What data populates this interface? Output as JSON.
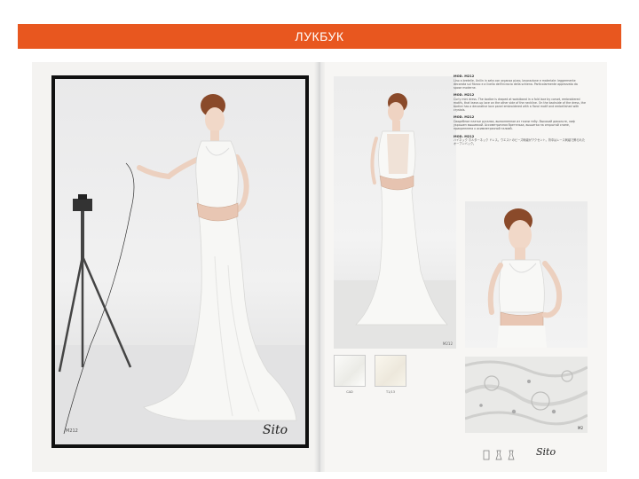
{
  "slide": {
    "title": "ЛУКБУК",
    "accent_color": "#e8571f"
  },
  "left_page": {
    "model_code": "M212",
    "signature": "Sito"
  },
  "right_page": {
    "back_view_code": "M212",
    "text_sections": [
      {
        "heading": "MOD. M212",
        "body": "Lino a bretelle, Unilin in seta con organza pizzo, lavorazione e materiale: leggermente decorata sul fianco e a livello dell'incrocio della schiena. Particolarmente apprezzato da spose moderne."
      },
      {
        "heading": "MOD. M212",
        "body": "Curly mini dress. The bodice is draped at waistband in a fold lace by corset, embroidered motifs, that leave-up lace on the other side of the neckline. On the backside of the dress, the bodice has a decorative lace panel embroidered with a floral motif and embellished with crystals."
      },
      {
        "heading": "MOD. M212",
        "body": "Свадебное платье русалка, выполненное из ткани тейу. Высокий декольте, лиф украшен вышивкой. Ассиметричная бретелька, вышитая на открытой спине, прикреплена к асимметричной талией."
      },
      {
        "heading": "MOD. M212",
        "body": "ハイネック ホルターネック ドレス。ウエストのビーズ刺繍がアクセント。背中はレース刺繍で飾られたオープンバック。"
      }
    ],
    "swatches": [
      {
        "label": "CAD",
        "color": "#f3f3ef"
      },
      {
        "label": "T1/13",
        "color": "#f1ece0"
      }
    ],
    "detail_code": "M2",
    "signature": "Sito"
  }
}
